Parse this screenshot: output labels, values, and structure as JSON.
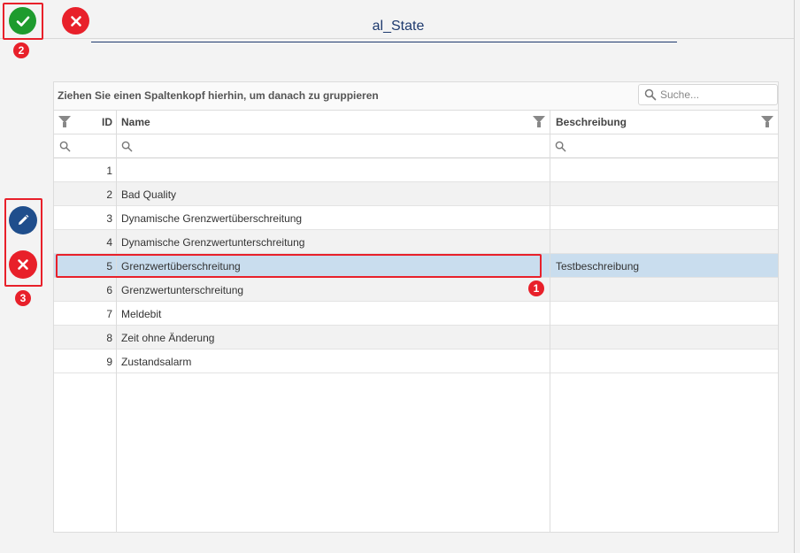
{
  "header": {
    "title": "al_State",
    "confirm_icon": "check-icon",
    "cancel_icon": "close-icon"
  },
  "side_actions": {
    "edit_icon": "pencil-icon",
    "delete_icon": "close-icon"
  },
  "annotations": {
    "badge_1": "1",
    "badge_2": "2",
    "badge_3": "3"
  },
  "grid": {
    "group_hint": "Ziehen Sie einen Spaltenkopf hierhin, um danach zu gruppieren",
    "search_placeholder": "Suche...",
    "columns": {
      "id": "ID",
      "name": "Name",
      "description": "Beschreibung"
    },
    "rows": [
      {
        "id": "1",
        "name": "",
        "description": ""
      },
      {
        "id": "2",
        "name": "Bad Quality",
        "description": ""
      },
      {
        "id": "3",
        "name": "Dynamische Grenzwertüberschreitung",
        "description": ""
      },
      {
        "id": "4",
        "name": "Dynamische Grenzwertunterschreitung",
        "description": ""
      },
      {
        "id": "5",
        "name": "Grenzwertüberschreitung",
        "description": "Testbeschreibung"
      },
      {
        "id": "6",
        "name": "Grenzwertunterschreitung",
        "description": ""
      },
      {
        "id": "7",
        "name": "Meldebit",
        "description": ""
      },
      {
        "id": "8",
        "name": "Zeit ohne Änderung",
        "description": ""
      },
      {
        "id": "9",
        "name": "Zustandsalarm",
        "description": ""
      }
    ],
    "selected_row": 4
  },
  "colors": {
    "accent": "#1e3a6e",
    "confirm": "#1e9b2e",
    "cancel": "#e8202a",
    "edit": "#1f4e8c",
    "selected_row": "#c9ddee"
  }
}
